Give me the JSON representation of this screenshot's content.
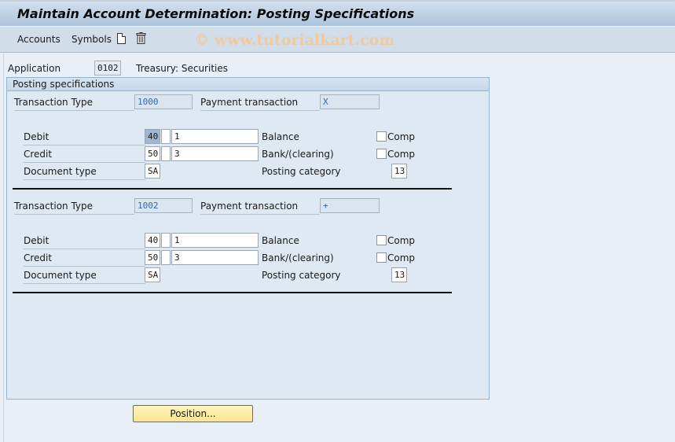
{
  "window": {
    "title": "Maintain Account Determination: Posting Specifications"
  },
  "toolbar": {
    "items": [
      "Accounts",
      "Symbols"
    ],
    "icons": [
      "new-document-icon",
      "delete-trash-icon"
    ],
    "watermark": "© www.tutorialkart.com"
  },
  "header": {
    "application_label": "Application",
    "application_value": "0102",
    "application_desc": "Treasury: Securities"
  },
  "group": {
    "title": "Posting specifications",
    "labels": {
      "transaction_type": "Transaction Type",
      "payment_transaction": "Payment transaction",
      "debit": "Debit",
      "credit": "Credit",
      "document_type": "Document type",
      "posting_category": "Posting category",
      "comp": "Comp"
    },
    "blocks": [
      {
        "transaction_type": "1000",
        "payment_transaction": "X",
        "debit": {
          "posting_key": "40",
          "flag": "",
          "account_symbol": "1",
          "desc": "Balance",
          "comp": false
        },
        "credit": {
          "posting_key": "50",
          "flag": "",
          "account_symbol": "3",
          "desc": "Bank/(clearing)",
          "comp": false
        },
        "document_type": "SA",
        "posting_category": "13"
      },
      {
        "transaction_type": "1002",
        "payment_transaction": "+",
        "debit": {
          "posting_key": "40",
          "flag": "",
          "account_symbol": "1",
          "desc": "Balance",
          "comp": false
        },
        "credit": {
          "posting_key": "50",
          "flag": "",
          "account_symbol": "3",
          "desc": "Bank/(clearing)",
          "comp": false
        },
        "document_type": "SA",
        "posting_category": "13"
      }
    ]
  },
  "footer": {
    "position_button": "Position..."
  }
}
